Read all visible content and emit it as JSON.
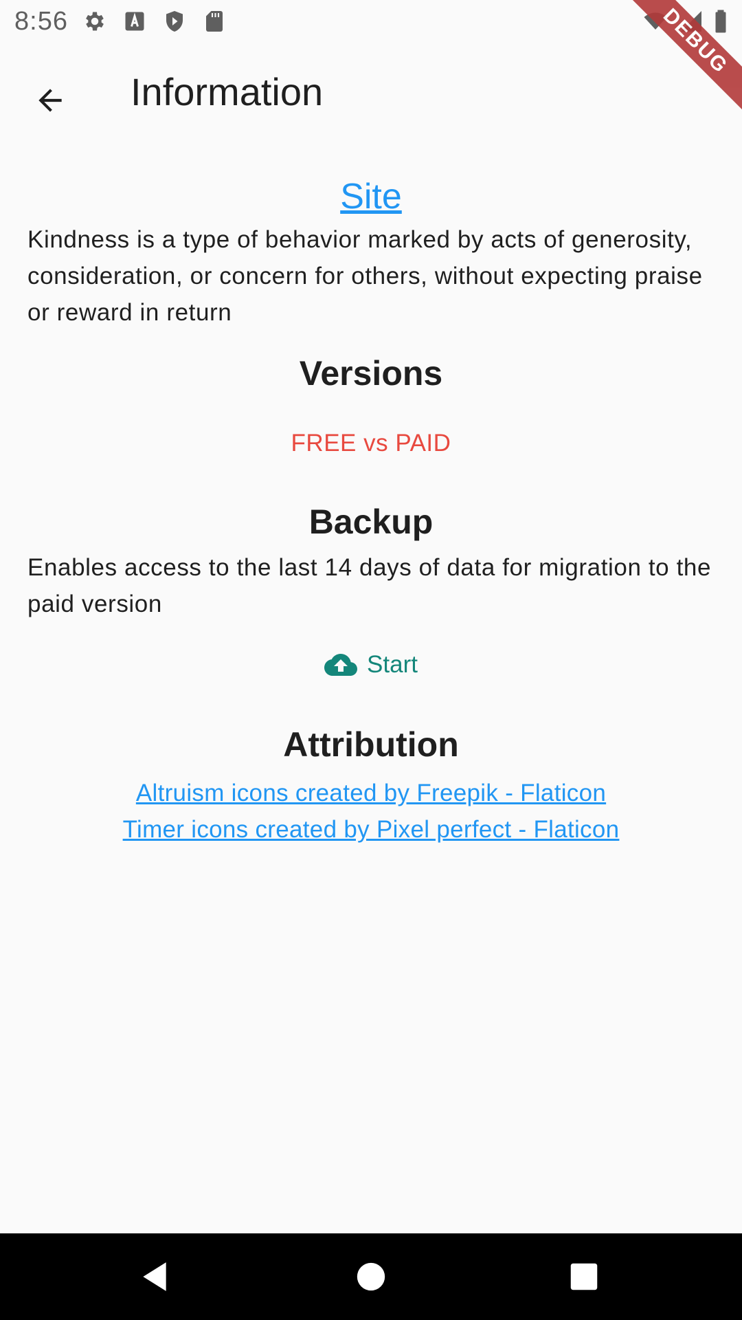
{
  "status_bar": {
    "time": "8:56",
    "icons": [
      "gear-icon",
      "font-a-icon",
      "play-shield-icon",
      "sd-card-icon",
      "wifi-icon",
      "signal-icon",
      "battery-icon"
    ]
  },
  "debug_banner": {
    "label": "DEBUG",
    "color": "#b23a3a"
  },
  "app_bar": {
    "title": "Information",
    "back_icon": "arrow-back-icon"
  },
  "content": {
    "site_link": "Site",
    "description": "Kindness is a type of behavior marked by acts of generosity, consideration, or concern for others, without expecting praise or reward in return",
    "versions": {
      "heading": "Versions",
      "link": "FREE vs PAID",
      "link_color": "#e8493f"
    },
    "backup": {
      "heading": "Backup",
      "description": "Enables access to the last 14 days of data for migration to the paid version",
      "button_label": "Start",
      "button_icon": "cloud-upload-icon",
      "button_color": "#14867a"
    },
    "attribution": {
      "heading": "Attribution",
      "links": [
        "Altruism icons created by Freepik - Flaticon",
        "Timer icons created by Pixel perfect - Flaticon"
      ]
    }
  },
  "colors": {
    "link": "#2196f3",
    "background": "#fafafa",
    "nav_bar": "#000000"
  },
  "nav_bar": {
    "buttons": [
      "back-triangle-icon",
      "home-circle-icon",
      "recents-square-icon"
    ]
  }
}
